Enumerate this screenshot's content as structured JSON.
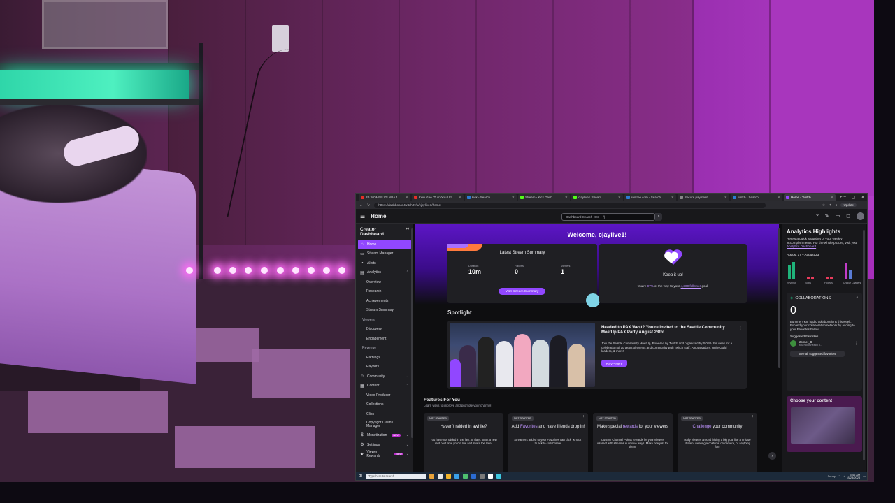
{
  "browser": {
    "tabs": [
      {
        "label": "2B WOMEN VS NBA 1",
        "color": "#e52d27"
      },
      {
        "label": "Kelo Gee \"Turn You Up\"",
        "color": "#e52d27"
      },
      {
        "label": "kick - Search",
        "color": "#2b7cd3"
      },
      {
        "label": "Stream - Kick Dash",
        "color": "#53fc18"
      },
      {
        "label": "cjaylive1 Stream",
        "color": "#53fc18"
      },
      {
        "label": "restree.com - Search",
        "color": "#2b7cd3"
      },
      {
        "label": "Secure payment",
        "color": "#888888"
      },
      {
        "label": "twitch - Search",
        "color": "#2b7cd3"
      },
      {
        "label": "Home - Twitch",
        "color": "#9147ff"
      }
    ],
    "url": "https://dashboard.twitch.tv/u/cjaylive1/home",
    "update_label": "Update"
  },
  "topnav": {
    "title": "Home",
    "search_placeholder": "Dashboard Search (Ctrl + /)"
  },
  "sidebar": {
    "heading": "Creator Dashboard",
    "items": [
      {
        "label": "Home",
        "icon": "⌂",
        "kind": "item",
        "active": true
      },
      {
        "label": "Stream Manager",
        "icon": "▭",
        "kind": "item"
      },
      {
        "label": "Alerts",
        "icon": "◔",
        "kind": "item"
      },
      {
        "label": "Analytics",
        "icon": "▤",
        "kind": "item",
        "chevron": "⌃"
      },
      {
        "label": "Overview",
        "kind": "sub"
      },
      {
        "label": "Research",
        "kind": "sub"
      },
      {
        "label": "Achievements",
        "kind": "sub"
      },
      {
        "label": "Stream Summary",
        "kind": "sub"
      },
      {
        "label": "Viewers",
        "kind": "group"
      },
      {
        "label": "Discovery",
        "kind": "sub"
      },
      {
        "label": "Engagement",
        "kind": "sub"
      },
      {
        "label": "Revenue",
        "kind": "group"
      },
      {
        "label": "Earnings",
        "kind": "sub"
      },
      {
        "label": "Payouts",
        "kind": "sub"
      },
      {
        "label": "Community",
        "icon": "☺",
        "kind": "item",
        "chevron": "⌄"
      },
      {
        "label": "Content",
        "icon": "▦",
        "kind": "item",
        "chevron": "⌃"
      },
      {
        "label": "Video Producer",
        "kind": "sub"
      },
      {
        "label": "Collections",
        "kind": "sub"
      },
      {
        "label": "Clips",
        "kind": "sub"
      },
      {
        "label": "Copyright Claims Manager",
        "kind": "sub"
      },
      {
        "label": "Monetization",
        "icon": "$",
        "kind": "item",
        "badge": "NEW",
        "chevron": "⌄"
      },
      {
        "label": "Settings",
        "icon": "⚙",
        "kind": "item",
        "chevron": "⌄"
      },
      {
        "label": "Viewer Rewards",
        "icon": "★",
        "kind": "item",
        "badge": "NEW",
        "chevron": "⌄"
      }
    ]
  },
  "main": {
    "welcome": "Welcome, cjaylive1!",
    "summary": {
      "title": "Latest Stream Summary",
      "stats": [
        {
          "label": "Duration",
          "value": "10m"
        },
        {
          "label": "Follows",
          "value": "0"
        },
        {
          "label": "Viewers",
          "value": "1"
        }
      ],
      "button": "Visit Stream Summary"
    },
    "goal": {
      "title": "Keep it up!",
      "text_prefix": "You're ",
      "percent": "97%",
      "text_mid": " of the way to your ",
      "target": "4,300 follower",
      "text_suffix": " goal!"
    },
    "spotlight": {
      "title": "Spotlight",
      "headline": "Headed to PAX West? You're invited to the Seattle Community MeetUp PAX Party August 28th!",
      "body": "Join the Seattle Community MeetUp, Powered by Twitch and organized by SOBA this week for a celebration of 10 years of events and community with Twitch staff, Ambassadors, Unity Guild leaders, & more!",
      "button": "RSVP Here"
    },
    "features": {
      "title": "Features For You",
      "subtitle": "Learn ways to improve and promote your channel",
      "cards": [
        {
          "badge": "NOT STARTED",
          "title_pre": "Haven't raided in awhile?",
          "title_hl": "",
          "title_post": "",
          "text": "You have not raided in the last 30 days. Start a new raid next time you're live and share the love."
        },
        {
          "badge": "NOT STARTED",
          "title_pre": "Add ",
          "title_hl": "Favorites",
          "title_post": " and have friends drop in!",
          "text": "Streamers added to your Favorites can click \"Knock\" to ask to collaborate."
        },
        {
          "badge": "NOT STARTED",
          "title_pre": "Make special ",
          "title_hl": "rewards",
          "title_post": " for your viewers",
          "text": "Custom Channel Points rewards let your viewers interact with streams in unique ways. Make one just for them!"
        },
        {
          "badge": "NOT STARTED",
          "title_pre": "",
          "title_hl": "Challenge",
          "title_post": " your community",
          "text": "Rally viewers around hitting a big goal like a unique stream, wearing a costume on camera, or anything fun!"
        }
      ]
    }
  },
  "analytics": {
    "title": "Analytics Highlights",
    "desc": "Here's a quick snapshot of your weekly accomplishments. For the whole picture, visit your ",
    "link": "Analytics Dashboard",
    "date_range": "August 17 – August 23",
    "bars": [
      {
        "label": "Revenue",
        "values": [
          0.7,
          0.9
        ],
        "color": "#1fb37a"
      },
      {
        "label": "Subs",
        "values": [
          0.1,
          0.1
        ],
        "color": "#e83c5c"
      },
      {
        "label": "Follows",
        "values": [
          0.1,
          0.1
        ],
        "color": "#e83c5c"
      },
      {
        "label": "Unique Chatters",
        "values": [
          0.85,
          0.5
        ],
        "color": "#c13cc8"
      }
    ]
  },
  "collab": {
    "title": "COLLABORATIONS",
    "count": "0",
    "text": "Bummer! You had 0 collaborations this week. Expand your collaboration network by adding to your Favorites below.",
    "suggested_label": "Suggested Favorites",
    "suggest_name": "stormer_B",
    "suggest_sub": "You Follow each o...",
    "see_all": "See all suggested favorites"
  },
  "choose": {
    "title": "Choose your content"
  },
  "taskbar": {
    "search_placeholder": "Type here to search",
    "weather": "Sunny",
    "time": "5:46 AM",
    "date": "8/23/2023"
  }
}
